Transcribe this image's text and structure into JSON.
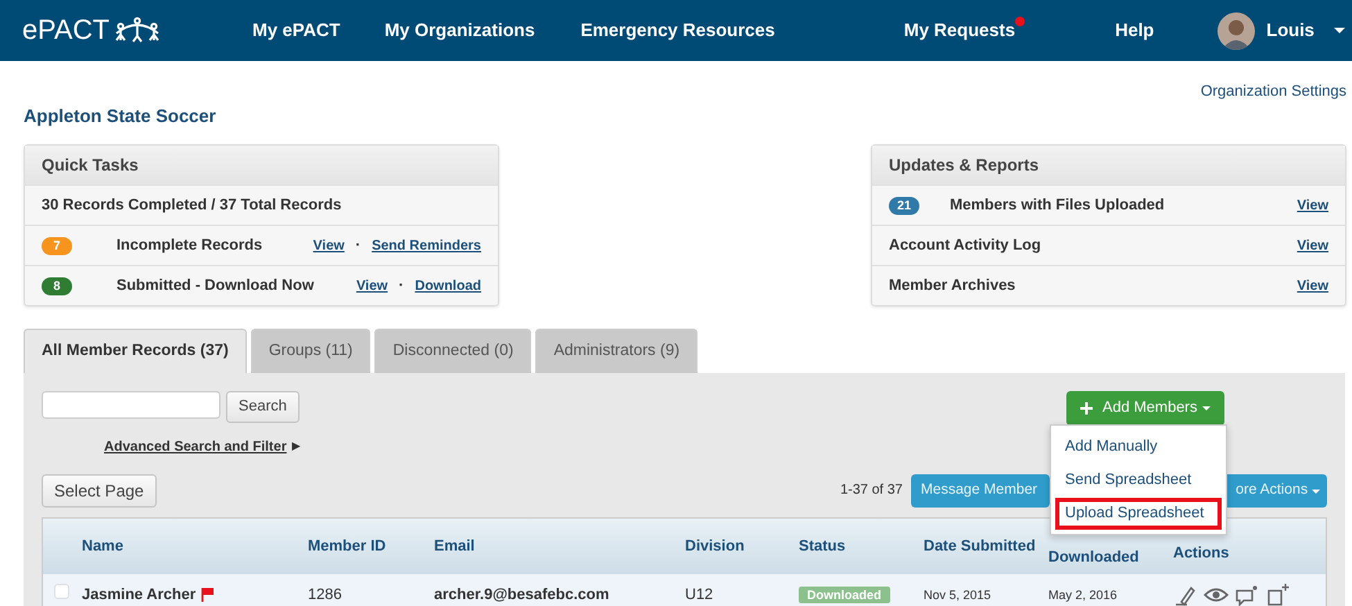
{
  "nav": {
    "brand": "ePACT",
    "items": [
      {
        "label": "My ePACT",
        "notification": false
      },
      {
        "label": "My Organizations",
        "notification": false
      },
      {
        "label": "Emergency Resources",
        "notification": false
      },
      {
        "label": "My Requests",
        "notification": true
      },
      {
        "label": "Help",
        "notification": false
      }
    ],
    "user": {
      "name": "Louis"
    }
  },
  "org": {
    "title": "Appleton State Soccer",
    "settings": "Organization Settings"
  },
  "quick_tasks": {
    "title": "Quick Tasks",
    "summary": "30 Records Completed / 37 Total Records",
    "rows": [
      {
        "count": "7",
        "color": "#f7941d",
        "label": "Incomplete Records",
        "links": [
          "View",
          "Send Reminders"
        ],
        "separator": "·"
      },
      {
        "count": "8",
        "color": "#2e7d32",
        "label": "Submitted - Download Now",
        "links": [
          "View",
          "Download"
        ],
        "separator": "·"
      }
    ]
  },
  "updates": {
    "title": "Updates & Reports",
    "rows": [
      {
        "count": "21",
        "color": "#2f7aa8",
        "label": "Members with Files Uploaded",
        "link": "View"
      },
      {
        "label": "Account Activity Log",
        "link": "View"
      },
      {
        "label": "Member Archives",
        "link": "View"
      }
    ]
  },
  "tabs": [
    {
      "label": "All Member Records (37)",
      "selected": true
    },
    {
      "label": "Groups (11)",
      "selected": false
    },
    {
      "label": "Disconnected (0)",
      "selected": false
    },
    {
      "label": "Administrators (9)",
      "selected": false
    }
  ],
  "toolbar": {
    "search_button": "Search",
    "advanced": "Advanced Search and Filter",
    "advanced_arrow": "▶",
    "select_page": "Select Page",
    "range": "1-37 of 37",
    "message_button": "Message Member",
    "more_button": "ore Actions"
  },
  "add_members": {
    "label": "Add Members",
    "expanded": true,
    "menu": [
      {
        "label": "Add Manually",
        "highlighted": false
      },
      {
        "label": "Send Spreadsheet",
        "highlighted": false
      },
      {
        "label": "Upload Spreadsheet",
        "highlighted": true
      }
    ]
  },
  "table": {
    "columns": [
      "Name",
      "Member ID",
      "Email",
      "Division",
      "Status",
      "Date Submitted",
      "Downloaded",
      "Actions"
    ],
    "rows": [
      {
        "checked": false,
        "name": "Jasmine Archer",
        "flagged": true,
        "member_id": "1286",
        "email": "archer.9@besafebc.com",
        "division": "U12",
        "status": "Downloaded",
        "date_submitted": "Nov 5, 2015",
        "downloaded": "May 2, 2016"
      }
    ]
  }
}
